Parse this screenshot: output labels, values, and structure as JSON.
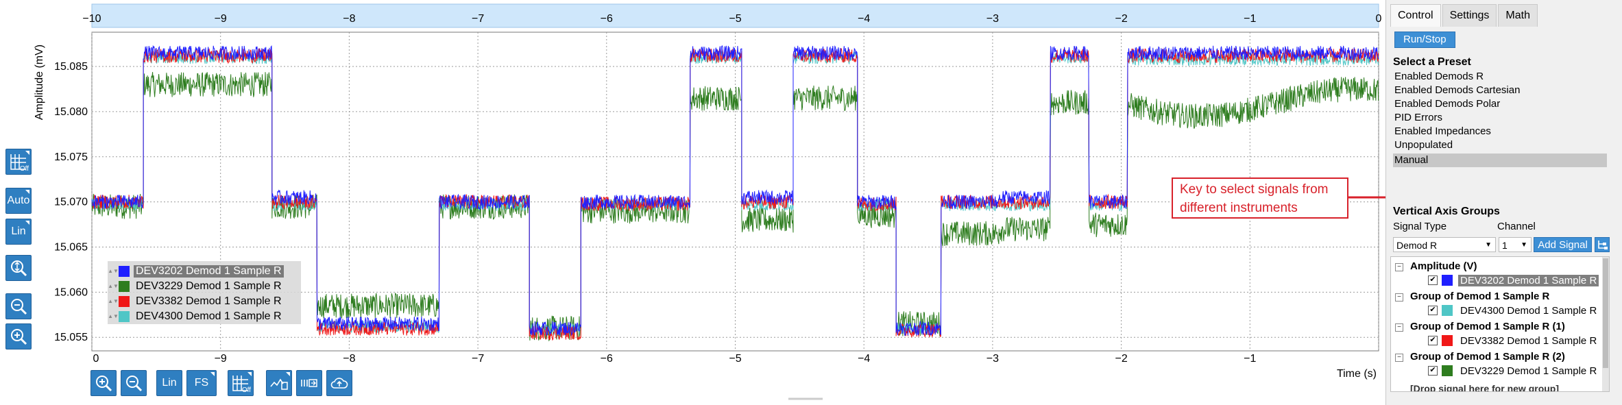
{
  "plot": {
    "y_axis_label": "Amplitude (mV)",
    "x_axis_label": "Time (s)",
    "top_axis_ticks": [
      "−10",
      "−9",
      "−8",
      "−7",
      "−6",
      "−5",
      "−4",
      "−3",
      "−2",
      "−1",
      "0"
    ],
    "bottom_axis_ticks": [
      "0",
      "−9",
      "−8",
      "−7",
      "−6",
      "−5",
      "−4",
      "−3",
      "−2",
      "−1"
    ],
    "y_ticks": [
      "15.085",
      "15.080",
      "15.075",
      "15.070",
      "15.065",
      "15.060",
      "15.055"
    ]
  },
  "legend": [
    {
      "label": "DEV3202 Demod 1 Sample R",
      "color": "#1f1fff",
      "selected": true
    },
    {
      "label": "DEV3229 Demod 1 Sample R",
      "color": "#2e7d1f",
      "selected": false
    },
    {
      "label": "DEV3382 Demod 1 Sample R",
      "color": "#f01818",
      "selected": false
    },
    {
      "label": "DEV4300 Demod 1 Sample R",
      "color": "#4fc6c6",
      "selected": false
    }
  ],
  "left_toolbar": {
    "grid_label": "Off",
    "auto_label": "Auto",
    "lin_label": "Lin"
  },
  "bottom_toolbar": {
    "lin_label": "Lin",
    "fs_label": "FS",
    "grid_label": "Off"
  },
  "panel": {
    "tabs": [
      "Control",
      "Settings",
      "Math"
    ],
    "run_stop": "Run/Stop",
    "preset_title": "Select a Preset",
    "presets": [
      "Enabled Demods R",
      "Enabled Demods Cartesian",
      "Enabled Demods Polar",
      "PID Errors",
      "Enabled Impedances",
      "Unpopulated",
      "Manual"
    ],
    "vag_title": "Vertical Axis Groups",
    "signal_type_label": "Signal Type",
    "channel_label": "Channel",
    "signal_type_value": "Demod R",
    "channel_value": "1",
    "add_signal": "Add Signal",
    "tree": [
      {
        "group": "Amplitude (V)",
        "signal": "DEV3202 Demod 1 Sample R",
        "color": "#1f1fff",
        "selected": true
      },
      {
        "group": "Group of Demod 1 Sample R",
        "signal": "DEV4300 Demod 1 Sample R",
        "color": "#4fc6c6",
        "selected": false
      },
      {
        "group": "Group of Demod 1 Sample R (1)",
        "signal": "DEV3382 Demod 1 Sample R",
        "color": "#f01818",
        "selected": false
      },
      {
        "group": "Group of Demod 1 Sample R (2)",
        "signal": "DEV3229 Demod 1 Sample R",
        "color": "#2e7d1f",
        "selected": false
      }
    ],
    "drop_note": "[Drop signal here for new group]"
  },
  "annotation": {
    "line1": "Key to select signals from",
    "line2": "different instruments"
  },
  "chart_data": {
    "type": "line",
    "xlabel": "Time (s)",
    "ylabel": "Amplitude (mV)",
    "xlim": [
      -10,
      0
    ],
    "ylim": [
      15.0535,
      15.0888
    ],
    "grid": true,
    "legend_position": "bottom-left",
    "segments_x": [
      -10,
      -9.6,
      -8.6,
      -8.25,
      -7.3,
      -6.6,
      -6.2,
      -5.35,
      -4.95,
      -4.55,
      -4.05,
      -3.75,
      -3.4,
      -2.95,
      -2.55,
      -2.25,
      -1.95,
      0
    ],
    "series": [
      {
        "name": "DEV3202 Demod 1 Sample R",
        "color": "#1f1fff",
        "levels": [
          15.07,
          15.0865,
          15.0705,
          15.0565,
          15.07,
          15.056,
          15.07,
          15.0865,
          15.0705,
          15.0865,
          15.07,
          15.056,
          15.07,
          15.0705,
          15.0865,
          15.07,
          15.0865
        ],
        "noise": 0.0008
      },
      {
        "name": "DEV3229 Demod 1 Sample R",
        "color": "#2e7d1f",
        "levels": [
          15.0695,
          15.083,
          15.0695,
          15.0585,
          15.0695,
          15.056,
          15.069,
          15.0815,
          15.068,
          15.0815,
          15.0685,
          15.0565,
          15.0665,
          15.067,
          15.081,
          15.0675,
          15.081
        ],
        "noise": 0.0014
      },
      {
        "name": "DEV3382 Demod 1 Sample R",
        "color": "#f01818",
        "levels": [
          15.07,
          15.0862,
          15.07,
          15.056,
          15.07,
          15.0555,
          15.0698,
          15.0862,
          15.07,
          15.0862,
          15.0698,
          15.0558,
          15.07,
          15.07,
          15.0862,
          15.07,
          15.0862
        ],
        "noise": 0.0008
      },
      {
        "name": "DEV4300 Demod 1 Sample R",
        "color": "#4fc6c6",
        "levels": [
          15.0697,
          15.086,
          15.0697,
          15.0562,
          15.0697,
          15.0558,
          15.0697,
          15.086,
          15.0697,
          15.086,
          15.0697,
          15.056,
          15.0697,
          15.0697,
          15.086,
          15.0697,
          15.0858
        ],
        "noise": 0.0007
      }
    ]
  }
}
